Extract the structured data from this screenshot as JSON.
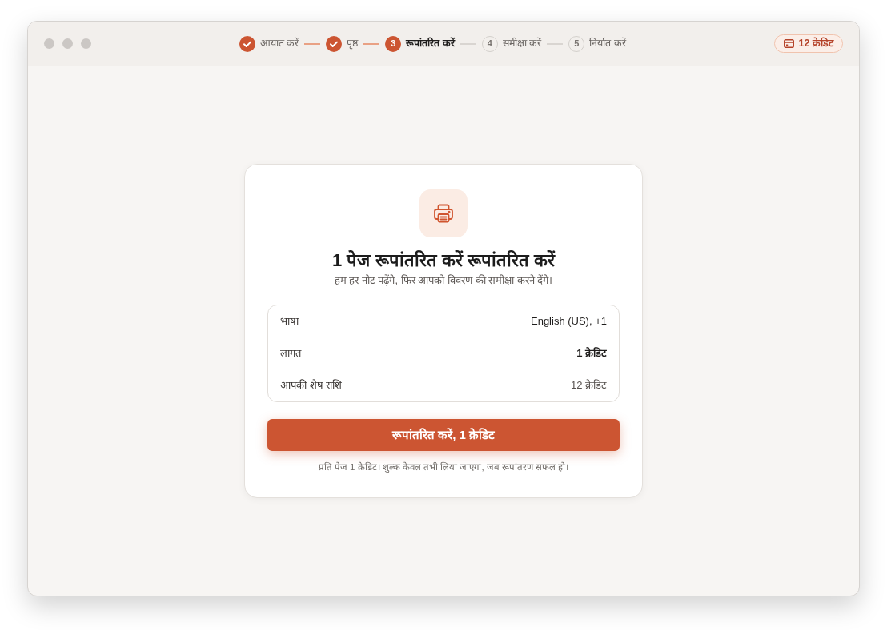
{
  "steps": [
    {
      "label": "आयात करें",
      "completed": true,
      "selected": false
    },
    {
      "label": "पृष्ठ",
      "completed": true,
      "selected": false
    },
    {
      "number": "3",
      "label": "रूपांतरित करें",
      "completed": false,
      "selected": true
    },
    {
      "number": "4",
      "label": "समीक्षा करें",
      "completed": false,
      "selected": false
    },
    {
      "number": "5",
      "label": "निर्यात करें",
      "completed": false,
      "selected": false
    }
  ],
  "credits_badge": {
    "label": "12 क्रेडिट"
  },
  "dialog": {
    "title": "1 पेज रूपांतरित करें रूपांतरित करें",
    "subtitle": "हम हर नोट पढ़ेंगे, फिर आपको विवरण की समीक्षा करने देंगे।",
    "details": [
      {
        "label": "भाषा",
        "value": "English (US), +1",
        "kind": "plain"
      },
      {
        "label": "लागत",
        "value": "1 क्रेडिट",
        "kind": "strong"
      },
      {
        "label": "आपकी शेष राशि",
        "value": "12 क्रेडिट",
        "kind": "muted"
      }
    ],
    "button": {
      "label": "रूपांतरित करें, 1 क्रेडिट"
    },
    "footnote": "प्रति पेज 1 क्रेडिट। शुल्क केवल तभी लिया जाएगा, जब रूपांतरण सफल हो।"
  }
}
